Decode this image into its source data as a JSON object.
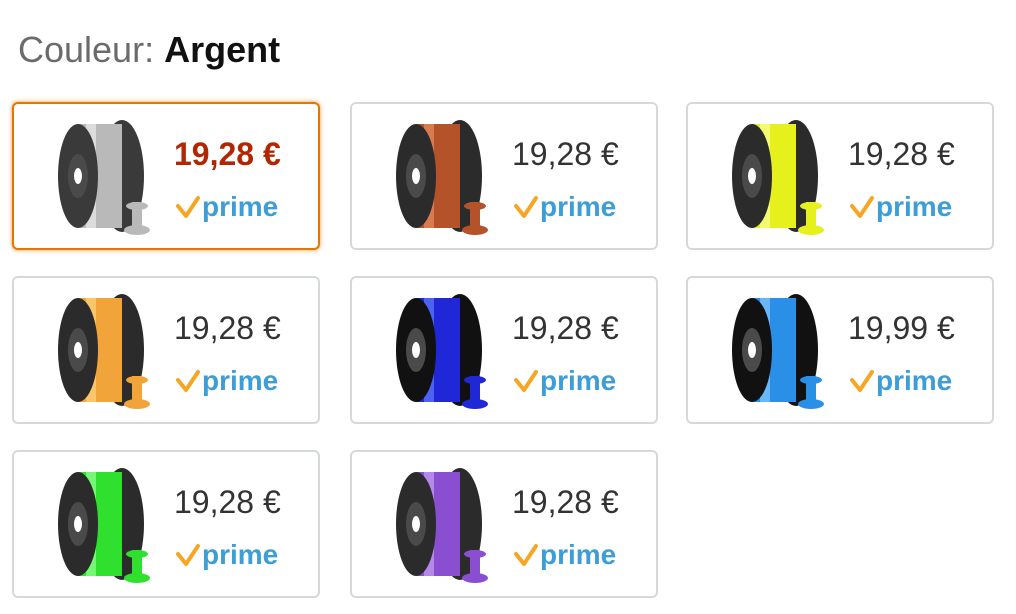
{
  "color_label": {
    "prefix": "Couleur:",
    "value": "Argent"
  },
  "prime_label": "prime",
  "colors": {
    "selected_border": "#e77600",
    "price_selected": "#b12704",
    "prime_check": "#f6a623",
    "prime_text": "#3d9dd6"
  },
  "swatches": [
    {
      "price": "19,28 €",
      "selected": true,
      "icon": "spool-silver-icon",
      "spool": "#b9b9b9",
      "spool_light": "#e8e8e8",
      "side": "#3a3a3a"
    },
    {
      "price": "19,28 €",
      "selected": false,
      "icon": "spool-copper-icon",
      "spool": "#b4532a",
      "spool_light": "#e38a5c",
      "side": "#2b2b2b"
    },
    {
      "price": "19,28 €",
      "selected": false,
      "icon": "spool-yellow-icon",
      "spool": "#e6f01d",
      "spool_light": "#f7ff8a",
      "side": "#2b2b2b"
    },
    {
      "price": "19,28 €",
      "selected": false,
      "icon": "spool-orange-icon",
      "spool": "#f0a43a",
      "spool_light": "#ffd27a",
      "side": "#2b2b2b"
    },
    {
      "price": "19,28 €",
      "selected": false,
      "icon": "spool-blue-icon",
      "spool": "#1f27d6",
      "spool_light": "#5a78ff",
      "side": "#111111"
    },
    {
      "price": "19,99 €",
      "selected": false,
      "icon": "spool-sky-blue-icon",
      "spool": "#2a8fe6",
      "spool_light": "#7cc4ff",
      "side": "#111111"
    },
    {
      "price": "19,28 €",
      "selected": false,
      "icon": "spool-green-icon",
      "spool": "#2fe02f",
      "spool_light": "#8dff8d",
      "side": "#2b2b2b"
    },
    {
      "price": "19,28 €",
      "selected": false,
      "icon": "spool-purple-icon",
      "spool": "#8a4fd1",
      "spool_light": "#c29cf0",
      "side": "#2b2b2b"
    }
  ]
}
